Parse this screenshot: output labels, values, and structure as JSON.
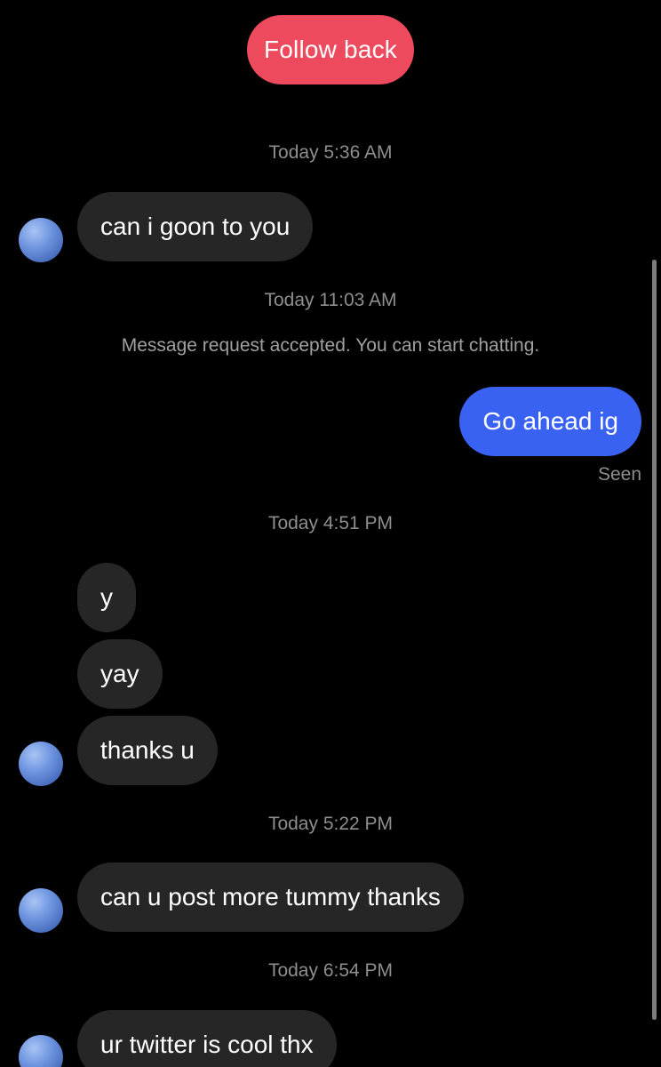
{
  "header": {
    "follow_back_label": "Follow back"
  },
  "thread": {
    "timestamps": [
      "Today 5:36 AM",
      "Today 11:03 AM",
      "Today 4:51 PM",
      "Today 5:22 PM",
      "Today 6:54 PM"
    ],
    "system_note": "Message request accepted. You can start chatting.",
    "messages": [
      {
        "direction": "incoming",
        "text": "can i goon to you"
      },
      {
        "direction": "outgoing",
        "text": "Go ahead ig"
      },
      {
        "direction": "incoming",
        "text": "y"
      },
      {
        "direction": "incoming",
        "text": "yay"
      },
      {
        "direction": "incoming",
        "text": "thanks u"
      },
      {
        "direction": "incoming",
        "text": "can u post more tummy thanks"
      },
      {
        "direction": "incoming",
        "text": "ur twitter is cool thx"
      }
    ],
    "seen_label": "Seen"
  },
  "colors": {
    "background": "#000000",
    "follow_back": "#ee4a5d",
    "incoming_bubble": "#262626",
    "outgoing_bubble": "#3a62f2",
    "timestamp_text": "#8e8e8e"
  },
  "icons": {
    "avatar": "sender-avatar"
  }
}
